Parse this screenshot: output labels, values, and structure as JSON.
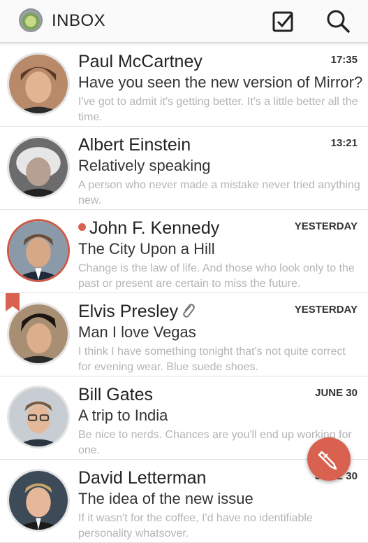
{
  "header": {
    "title": "INBOX",
    "logo_icon": "app-logo-icon",
    "actions": [
      {
        "icon": "select-checkbox-icon"
      },
      {
        "icon": "search-icon"
      }
    ]
  },
  "messages": [
    {
      "sender": "Paul McCartney",
      "time": "17:35",
      "subject": "Have you seen the new version of Mirror?",
      "preview": "I've got to admit it's getting better. It's a little better all the time.",
      "unread": false,
      "bookmarked": false,
      "attachment": false
    },
    {
      "sender": "Albert Einstein",
      "time": "13:21",
      "subject": "Relatively speaking",
      "preview": "A person who never made a mistake never tried anything new.",
      "unread": false,
      "bookmarked": false,
      "attachment": false
    },
    {
      "sender": "John F. Kennedy",
      "time": "YESTERDAY",
      "subject": "The City Upon a Hill",
      "preview": "Change is the law of life. And those who look only to the past or present are certain to miss the future.",
      "unread": true,
      "bookmarked": false,
      "attachment": false
    },
    {
      "sender": "Elvis Presley",
      "time": "YESTERDAY",
      "subject": "Man I love Vegas",
      "preview": "I think I have something tonight that's not quite correct for evening wear. Blue suede shoes.",
      "unread": false,
      "bookmarked": true,
      "attachment": true
    },
    {
      "sender": "Bill Gates",
      "time": "JUNE 30",
      "subject": "A trip to India",
      "preview": "Be nice to nerds. Chances are you'll end up working for one.",
      "unread": false,
      "bookmarked": false,
      "attachment": false
    },
    {
      "sender": "David Letterman",
      "time": "JUNE 30",
      "subject": "The idea of the new issue",
      "preview": "If it wasn't for the coffee, I'd have no identifiable personality whatsover.",
      "unread": false,
      "bookmarked": false,
      "attachment": false
    }
  ],
  "compose_button": {
    "icon": "compose-pen-icon"
  },
  "colors": {
    "accent": "#d9614f",
    "preview_text": "#b4b4b4",
    "divider": "#e2e2e2"
  }
}
